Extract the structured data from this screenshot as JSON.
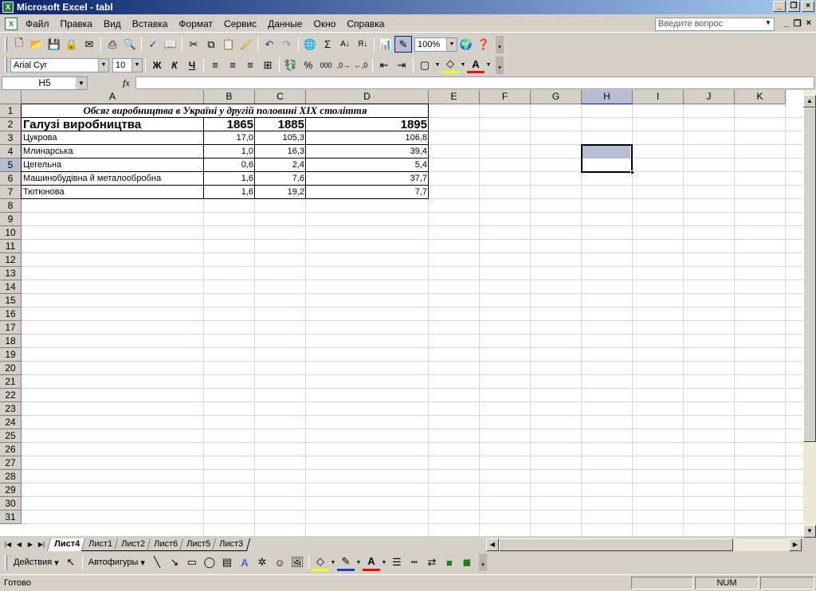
{
  "window": {
    "title": "Microsoft Excel - tabl"
  },
  "menu": {
    "items": [
      "Файл",
      "Правка",
      "Вид",
      "Вставка",
      "Формат",
      "Сервис",
      "Данные",
      "Окно",
      "Справка"
    ]
  },
  "help": {
    "placeholder": "Введите вопрос"
  },
  "toolbar": {
    "zoom": "100%"
  },
  "format": {
    "font_name": "Arial Cyr",
    "font_size": "10",
    "bold": "Ж",
    "italic": "К",
    "underline": "Ч",
    "percent": "%",
    "thousands": "000"
  },
  "formula": {
    "name_box": "H5",
    "fx": "fx",
    "content": ""
  },
  "columns": [
    "A",
    "B",
    "C",
    "D",
    "E",
    "F",
    "G",
    "H",
    "I",
    "J",
    "K"
  ],
  "selected_column": "H",
  "rows": [
    "1",
    "2",
    "3",
    "4",
    "5",
    "6",
    "7",
    "8",
    "9",
    "10",
    "11",
    "12",
    "13",
    "14",
    "15",
    "16",
    "17",
    "18",
    "19",
    "20",
    "21",
    "22",
    "23",
    "24",
    "25",
    "26",
    "27",
    "28",
    "29",
    "30",
    "31"
  ],
  "selected_row": "5",
  "sheet": {
    "title": "Обсяг виробництва в Україні у другій половині XIX століття",
    "header": [
      "Галузі виробництва",
      "1865",
      "1885",
      "1895"
    ],
    "data": [
      [
        "Цукрова",
        "17,0",
        "105,3",
        "106,8"
      ],
      [
        "Млинарська",
        "1,0",
        "16,3",
        "39,4"
      ],
      [
        "Цегельна",
        "0,6",
        "2,4",
        "5,4"
      ],
      [
        "Машинобудівна й металообробна",
        "1,6",
        "7,6",
        "37,7"
      ],
      [
        "Тютюнова",
        "1,6",
        "19,2",
        "7,7"
      ]
    ]
  },
  "tabs": [
    "Лист4",
    "Лист1",
    "Лист2",
    "Лист6",
    "Лист5",
    "Лист3"
  ],
  "active_tab": "Лист4",
  "drawing": {
    "actions": "Действия",
    "autoshapes": "Автофигуры"
  },
  "status": {
    "ready": "Готово",
    "num": "NUM"
  }
}
